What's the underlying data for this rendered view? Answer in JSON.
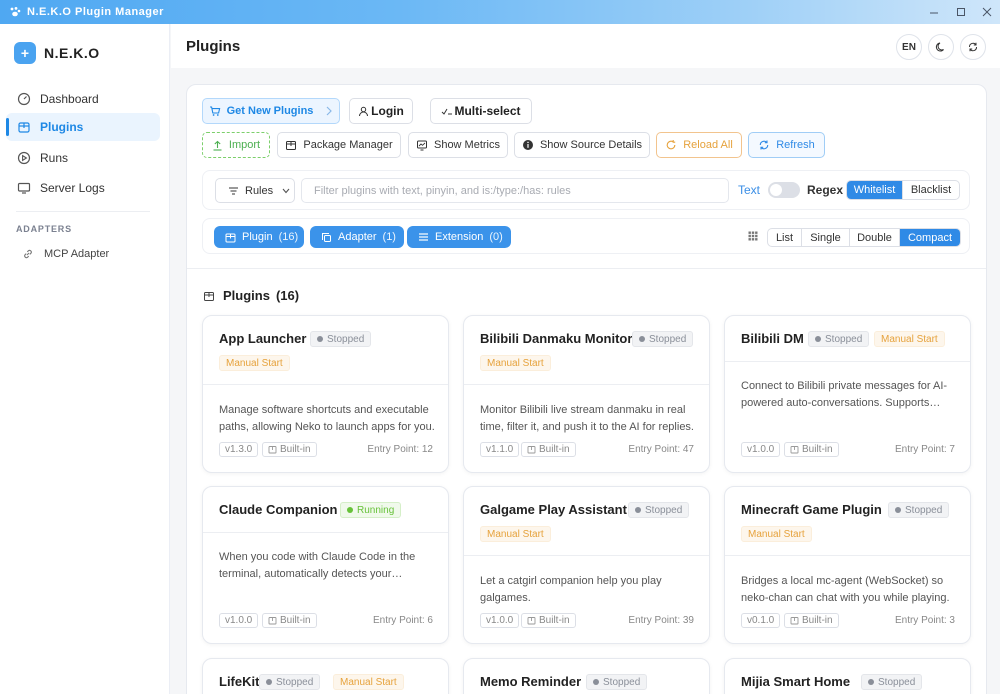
{
  "window": {
    "title": "N.E.K.O Plugin Manager"
  },
  "brand": {
    "name": "N.E.K.O",
    "logo_glyph": "+"
  },
  "sidebar": {
    "items": [
      {
        "label": "Dashboard",
        "icon": "gauge-icon"
      },
      {
        "label": "Plugins",
        "icon": "package-icon"
      },
      {
        "label": "Runs",
        "icon": "play-circle-icon"
      },
      {
        "label": "Server Logs",
        "icon": "monitor-icon"
      }
    ],
    "section": "ADAPTERS",
    "adapter_item": "MCP Adapter"
  },
  "header": {
    "title": "Plugins",
    "lang": "EN"
  },
  "toolbar": {
    "get_plugins": "Get New Plugins",
    "login": "Login",
    "multiselect": "Multi-select",
    "import": "Import",
    "package_manager": "Package Manager",
    "show_metrics": "Show Metrics",
    "show_source": "Show Source Details",
    "reload_all": "Reload All",
    "refresh": "Refresh"
  },
  "filter": {
    "rules": "Rules",
    "placeholder": "Filter plugins with text, pinyin, and is:/type:/has: rules",
    "text_label": "Text",
    "regex_label": "Regex",
    "whitelist": "Whitelist",
    "blacklist": "Blacklist"
  },
  "types": [
    {
      "label": "Plugin",
      "count": "(16)"
    },
    {
      "label": "Adapter",
      "count": "(1)"
    },
    {
      "label": "Extension",
      "count": "(0)"
    }
  ],
  "views": [
    "List",
    "Single",
    "Double",
    "Compact"
  ],
  "active_view": "Compact",
  "section": {
    "title": "Plugins",
    "count": "(16)"
  },
  "colors": {
    "accent": "#2f8ae6",
    "running": "#67c23a",
    "manual": "#e6a23c"
  },
  "plugins": [
    {
      "name": "App Launcher",
      "status": "Stopped",
      "manual": "Manual Start",
      "desc": "Manage software shortcuts and executable paths, allowing Neko to launch apps for you.",
      "version": "v1.3.0",
      "builtin": "Built-in",
      "entry": "Entry Point: 12"
    },
    {
      "name": "Bilibili Danmaku Monitor",
      "status": "Stopped",
      "manual": "Manual Start",
      "desc": "Monitor Bilibili live stream danmaku in real time, filter it, and push it to the AI for replies.",
      "version": "v1.1.0",
      "builtin": "Built-in",
      "entry": "Entry Point: 47"
    },
    {
      "name": "Bilibili DM",
      "status": "Stopped",
      "manual": "Manual Start",
      "desc": "Connect to Bilibili private messages for AI-powered auto-conversations. Supports many features.",
      "version": "v1.0.0",
      "builtin": "Built-in",
      "entry": "Entry Point: 7"
    },
    {
      "name": "Claude Companion",
      "status": "Running",
      "manual": "",
      "desc": "When you code with Claude Code in the terminal, automatically detects your progress.",
      "version": "v1.0.0",
      "builtin": "Built-in",
      "entry": "Entry Point: 6"
    },
    {
      "name": "Galgame Play Assistant",
      "status": "Stopped",
      "manual": "Manual Start",
      "desc": "Let a catgirl companion help you play galgames.",
      "version": "v1.0.0",
      "builtin": "Built-in",
      "entry": "Entry Point: 39"
    },
    {
      "name": "Minecraft Game Plugin",
      "status": "Stopped",
      "manual": "Manual Start",
      "desc": "Bridges a local mc-agent (WebSocket) so neko-chan can chat with you while playing.",
      "version": "v0.1.0",
      "builtin": "Built-in",
      "entry": "Entry Point: 3"
    },
    {
      "name": "LifeKit",
      "status": "Stopped",
      "manual": "Manual Start"
    },
    {
      "name": "Memo Reminder",
      "status": "Stopped",
      "manual": ""
    },
    {
      "name": "Mijia Smart Home",
      "status": "Stopped",
      "manual": ""
    }
  ]
}
